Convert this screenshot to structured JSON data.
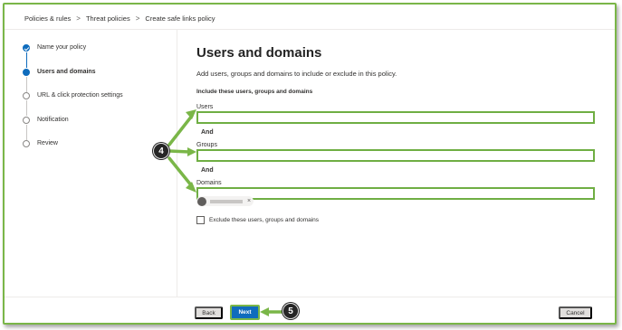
{
  "breadcrumb": [
    "Policies & rules",
    "Threat policies",
    "Create safe links policy"
  ],
  "breadcrumb_separator": ">",
  "steps": [
    {
      "label": "Name your policy",
      "state": "done"
    },
    {
      "label": "Users and domains",
      "state": "current"
    },
    {
      "label": "URL & click protection settings",
      "state": "pending"
    },
    {
      "label": "Notification",
      "state": "pending"
    },
    {
      "label": "Review",
      "state": "pending"
    }
  ],
  "main": {
    "title": "Users and domains",
    "subtitle": "Add users, groups and domains to include or exclude in this policy.",
    "section_heading": "Include these users, groups and domains",
    "users_label": "Users",
    "and_label_1": "And",
    "groups_label": "Groups",
    "and_label_2": "And",
    "domains_label": "Domains",
    "domain_chip_close": "×",
    "exclude_label": "Exclude these users, groups and domains",
    "exclude_checked": false
  },
  "footer": {
    "back_label": "Back",
    "next_label": "Next",
    "cancel_label": "Cancel"
  },
  "callouts": {
    "fields": "4",
    "next": "5"
  },
  "colors": {
    "accent": "#0f6cbd",
    "highlight": "#7ab648"
  }
}
